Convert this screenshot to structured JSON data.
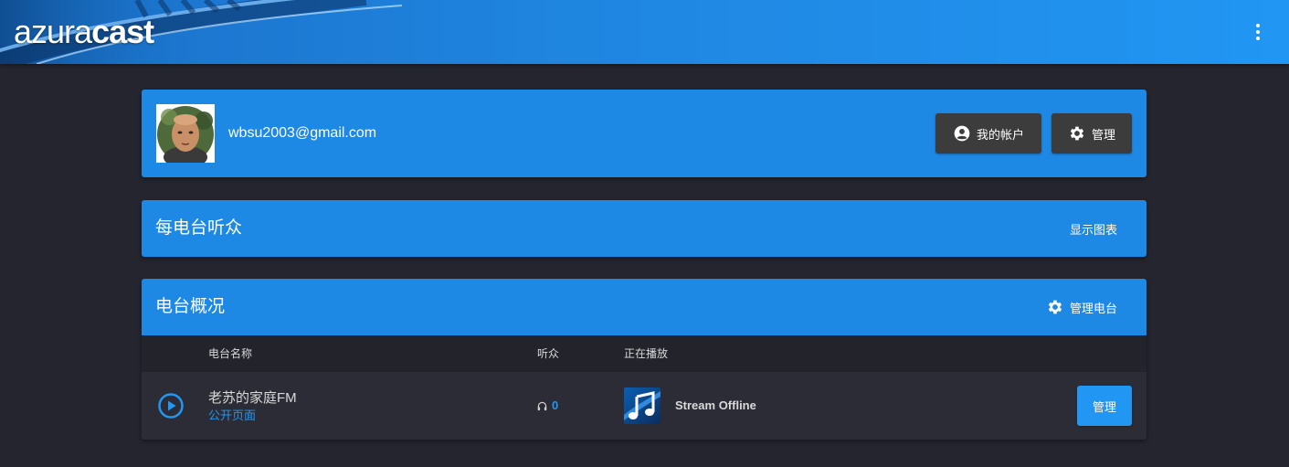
{
  "header": {
    "logo_part1": "azura",
    "logo_part2": "cast",
    "menu_icon": "more-vertical-icon",
    "color": "#1e88e5"
  },
  "user": {
    "email": "wbsu2003@gmail.com",
    "account_button": "我的帐户",
    "account_icon": "account-circle-icon",
    "admin_button": "管理",
    "admin_icon": "gear-icon"
  },
  "listeners_panel": {
    "title": "每电台听众",
    "show_chart": "显示图表"
  },
  "stations_panel": {
    "title": "电台概况",
    "manage_stations": "管理电台",
    "columns": {
      "name": "电台名称",
      "listeners": "听众",
      "now_playing": "正在播放"
    },
    "rows": [
      {
        "name": "老苏的家庭FM",
        "public_page": "公开页面",
        "listeners": "0",
        "now_playing": "Stream Offline",
        "manage": "管理"
      }
    ]
  },
  "colors": {
    "background": "#24252f",
    "panel": "#2b2c35",
    "accent": "#2196f3",
    "dark_button": "#3c3c3c"
  }
}
